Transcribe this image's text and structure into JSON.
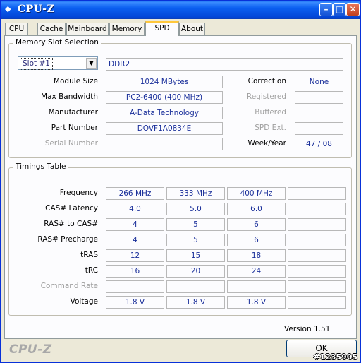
{
  "window": {
    "title": "CPU-Z"
  },
  "tabs": [
    {
      "label": "CPU"
    },
    {
      "label": "Cache"
    },
    {
      "label": "Mainboard"
    },
    {
      "label": "Memory"
    },
    {
      "label": "SPD",
      "active": true
    },
    {
      "label": "About"
    }
  ],
  "slot_selection": {
    "title": "Memory Slot Selection",
    "selected_slot": "Slot #1",
    "memory_type": "DDR2",
    "labels": {
      "module_size": "Module Size",
      "max_bandwidth": "Max Bandwidth",
      "manufacturer": "Manufacturer",
      "part_number": "Part Number",
      "serial_number": "Serial Number",
      "correction": "Correction",
      "registered": "Registered",
      "buffered": "Buffered",
      "spd_ext": "SPD Ext.",
      "week_year": "Week/Year"
    },
    "values": {
      "module_size": "1024 MBytes",
      "max_bandwidth": "PC2-6400 (400 MHz)",
      "manufacturer": "A-Data Technology",
      "part_number": "DOVF1A0834E",
      "serial_number": "",
      "correction": "None",
      "registered": "",
      "buffered": "",
      "spd_ext": "",
      "week_year": "47 / 08"
    }
  },
  "timings": {
    "title": "Timings Table",
    "rows": [
      {
        "label": "Frequency",
        "values": [
          "266 MHz",
          "333 MHz",
          "400 MHz",
          ""
        ]
      },
      {
        "label": "CAS# Latency",
        "values": [
          "4.0",
          "5.0",
          "6.0",
          ""
        ]
      },
      {
        "label": "RAS# to CAS#",
        "values": [
          "4",
          "5",
          "6",
          ""
        ]
      },
      {
        "label": "RAS# Precharge",
        "values": [
          "4",
          "5",
          "6",
          ""
        ]
      },
      {
        "label": "tRAS",
        "values": [
          "12",
          "15",
          "18",
          ""
        ]
      },
      {
        "label": "tRC",
        "values": [
          "16",
          "20",
          "24",
          ""
        ]
      },
      {
        "label": "Command Rate",
        "values": [
          "",
          "",
          "",
          ""
        ],
        "disabled": true
      },
      {
        "label": "Voltage",
        "values": [
          "1.8 V",
          "1.8 V",
          "1.8 V",
          ""
        ]
      }
    ]
  },
  "footer": {
    "version": "Version 1.51",
    "logo": "CPU-Z",
    "ok_label": "OK",
    "watermark": "#1235905"
  }
}
